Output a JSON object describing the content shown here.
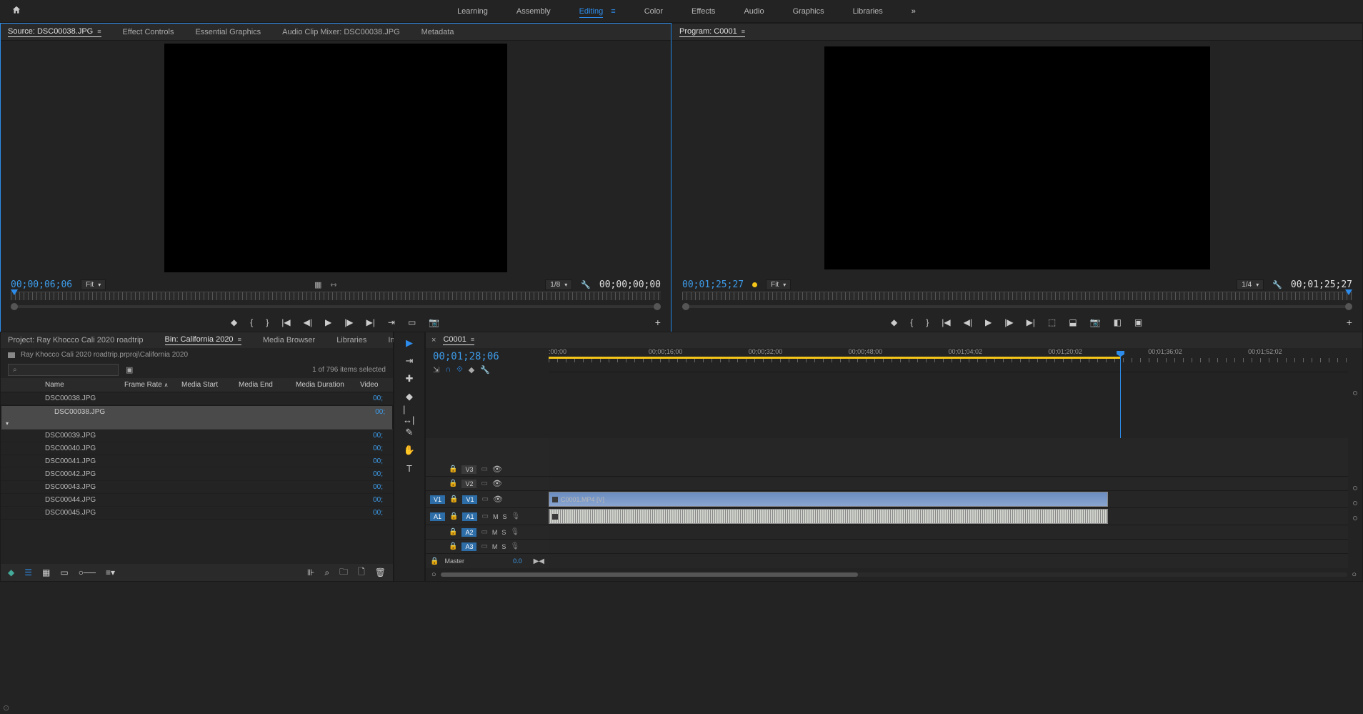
{
  "top": {
    "workspaces": [
      "Learning",
      "Assembly",
      "Editing",
      "Color",
      "Effects",
      "Audio",
      "Graphics",
      "Libraries"
    ],
    "active": "Editing"
  },
  "source": {
    "tabs": [
      "Source: DSC00038.JPG",
      "Effect Controls",
      "Essential Graphics",
      "Audio Clip Mixer: DSC00038.JPG",
      "Metadata"
    ],
    "active": 0,
    "tc_in": "00;00;06;06",
    "fit": "Fit",
    "res": "1/8",
    "tc_out": "00;00;00;00"
  },
  "program": {
    "title": "Program: C0001",
    "tc_in": "00;01;25;27",
    "fit": "Fit",
    "res": "1/4",
    "tc_out": "00;01;25;27"
  },
  "project": {
    "tabs": [
      "Project: Ray Khocco Cali 2020 roadtrip",
      "Bin: California 2020",
      "Media Browser",
      "Libraries",
      "Info"
    ],
    "active": 1,
    "path": "Ray Khocco Cali 2020 roadtrip.prproj\\California 2020",
    "search_icon": "⌕",
    "count": "1 of 796 items selected",
    "cols": {
      "name": "Name",
      "fr": "Frame Rate",
      "ms": "Media Start",
      "me": "Media End",
      "md": "Media Duration",
      "vid": "Video"
    },
    "rows": [
      {
        "name": "DSC00038.JPG",
        "dur": "00;"
      },
      {
        "name": "DSC00038.JPG",
        "dur": "00;",
        "sel": true
      },
      {
        "name": "DSC00039.JPG",
        "dur": "00;"
      },
      {
        "name": "DSC00040.JPG",
        "dur": "00;"
      },
      {
        "name": "DSC00041.JPG",
        "dur": "00;"
      },
      {
        "name": "DSC00042.JPG",
        "dur": "00;"
      },
      {
        "name": "DSC00043.JPG",
        "dur": "00;"
      },
      {
        "name": "DSC00044.JPG",
        "dur": "00;"
      },
      {
        "name": "DSC00045.JPG",
        "dur": "00;"
      }
    ]
  },
  "timeline": {
    "seq": "C0001",
    "tc": "00;01;28;06",
    "marks": [
      ":00;00",
      "00;00;16;00",
      "00;00;32;00",
      "00;00;48;00",
      "00;01;04;02",
      "00;01;20;02",
      "00;01;36;02",
      "00;01;52;02"
    ],
    "v_tracks": [
      "V3",
      "V2",
      "V1"
    ],
    "a_tracks": [
      "A1",
      "A2",
      "A3"
    ],
    "source_patch_v": "V1",
    "source_patch_a": "A1",
    "master": "Master",
    "master_val": "0.0",
    "clip_v": "C0001.MP4 [V]",
    "mute": "M",
    "solo": "S"
  }
}
